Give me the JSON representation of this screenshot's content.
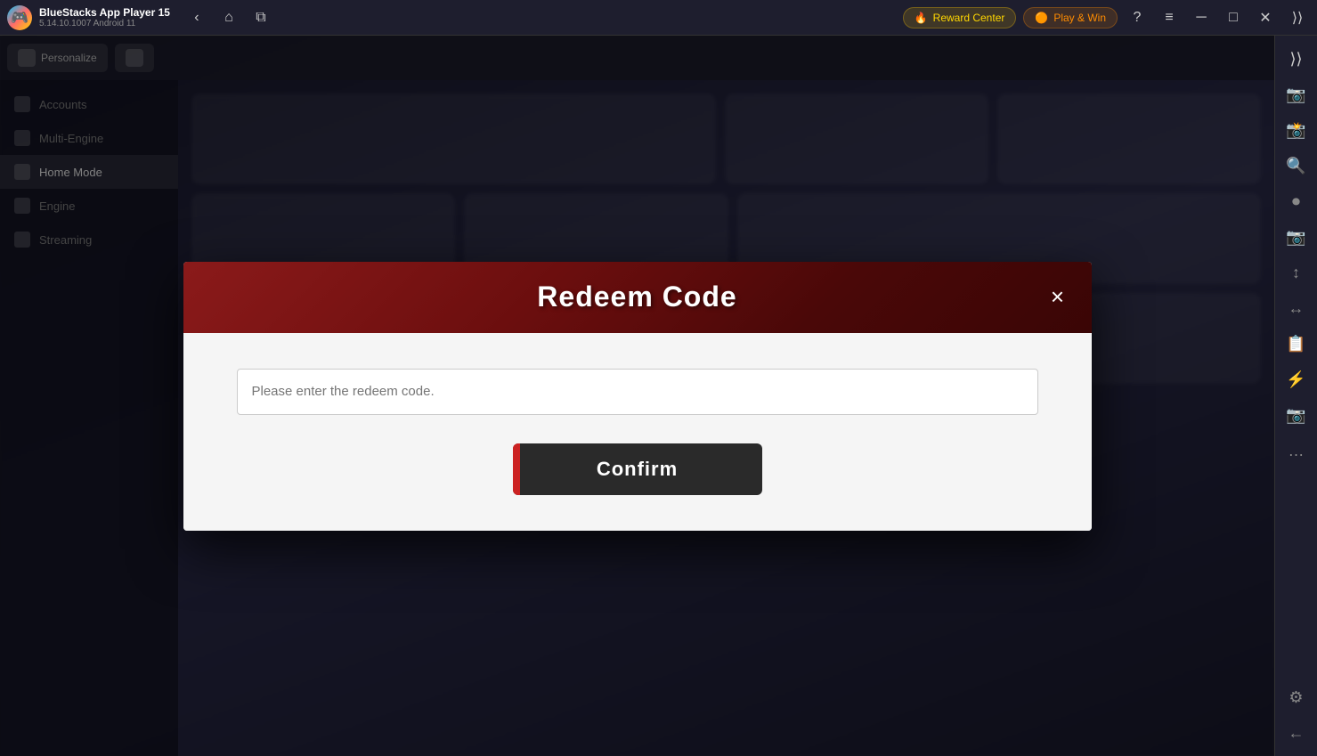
{
  "titlebar": {
    "app_name": "BlueStacks App Player 15",
    "version": "5.14.10.1007  Android 11",
    "logo_emoji": "🎮",
    "reward_center": "Reward Center",
    "play_win": "Play & Win",
    "reward_icon": "🔥",
    "play_icon": "🟠"
  },
  "nav_buttons": {
    "back": "‹",
    "home": "⌂",
    "multi": "⧉"
  },
  "titlebar_icons": {
    "help": "?",
    "menu": "≡",
    "minimize": "─",
    "maximize": "□",
    "close": "✕",
    "expand": "⟩⟩"
  },
  "right_sidebar": {
    "icons": [
      "⟩⟩",
      "📷",
      "📸",
      "🔍",
      "⏺",
      "📷",
      "↕",
      "↔",
      "📋",
      "⚡",
      "📷",
      "…",
      "⚙",
      "←"
    ]
  },
  "game_toolbar": {
    "btn1_label": "Personalize",
    "btn2_label": ""
  },
  "game_sidebar": {
    "items": [
      {
        "label": "Accounts",
        "active": false
      },
      {
        "label": "Multi-Engine",
        "active": false
      },
      {
        "label": "Home Mode",
        "active": true
      },
      {
        "label": "Engine",
        "active": false
      },
      {
        "label": "Streaming",
        "active": false
      }
    ]
  },
  "modal": {
    "title": "Redeem Code",
    "close_label": "×",
    "input_placeholder": "Please enter the redeem code.",
    "confirm_button": "Confirm",
    "description": ""
  },
  "colors": {
    "accent_red": "#cc2222",
    "btn_dark": "#2a2a2a",
    "modal_header_from": "#8b1a1a",
    "modal_header_to": "#3a0505"
  }
}
